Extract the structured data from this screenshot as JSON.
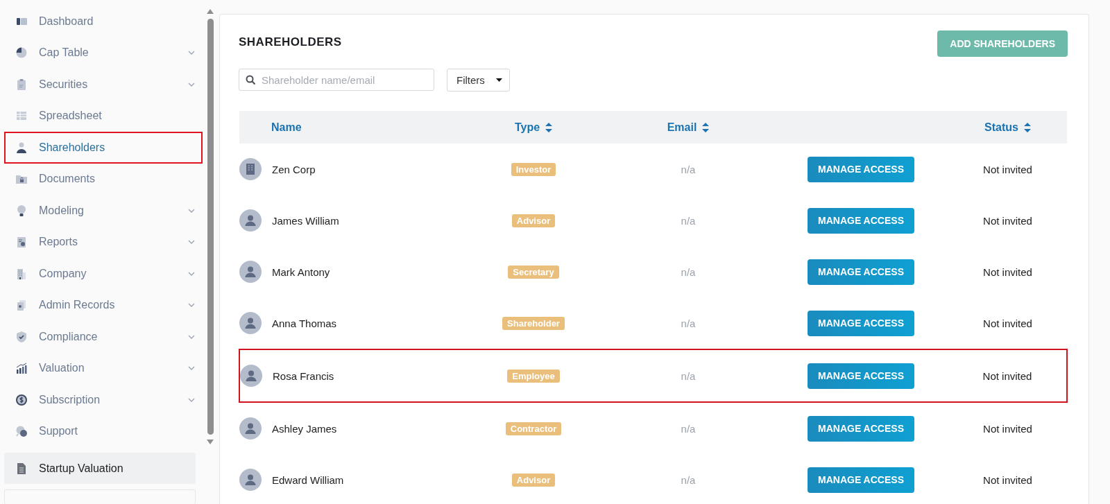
{
  "sidebar": {
    "items": [
      {
        "label": "Dashboard",
        "expandable": false,
        "selected": false,
        "highlighted": false
      },
      {
        "label": "Cap Table",
        "expandable": true,
        "selected": false,
        "highlighted": false
      },
      {
        "label": "Securities",
        "expandable": true,
        "selected": false,
        "highlighted": false
      },
      {
        "label": "Spreadsheet",
        "expandable": false,
        "selected": false,
        "highlighted": false
      },
      {
        "label": "Shareholders",
        "expandable": false,
        "selected": true,
        "highlighted": true
      },
      {
        "label": "Documents",
        "expandable": false,
        "selected": false,
        "highlighted": false
      },
      {
        "label": "Modeling",
        "expandable": true,
        "selected": false,
        "highlighted": false
      },
      {
        "label": "Reports",
        "expandable": true,
        "selected": false,
        "highlighted": false
      },
      {
        "label": "Company",
        "expandable": true,
        "selected": false,
        "highlighted": false
      },
      {
        "label": "Admin Records",
        "expandable": true,
        "selected": false,
        "highlighted": false
      },
      {
        "label": "Compliance",
        "expandable": true,
        "selected": false,
        "highlighted": false
      },
      {
        "label": "Valuation",
        "expandable": true,
        "selected": false,
        "highlighted": false
      },
      {
        "label": "Subscription",
        "expandable": true,
        "selected": false,
        "highlighted": false
      },
      {
        "label": "Support",
        "expandable": false,
        "selected": false,
        "highlighted": false
      }
    ],
    "footer_item": {
      "label": "Startup Valuation"
    }
  },
  "panel": {
    "title": "SHAREHOLDERS",
    "add_button": "ADD SHAREHOLDERS",
    "search": {
      "placeholder": "Shareholder name/email"
    },
    "filter": {
      "label": "Filters"
    }
  },
  "table": {
    "columns": [
      {
        "label": "Name",
        "sortable": false
      },
      {
        "label": "Type",
        "sortable": true
      },
      {
        "label": "Email",
        "sortable": true
      },
      {
        "sortable": false
      },
      {
        "label": "Status",
        "sortable": true
      }
    ],
    "rows": [
      {
        "name": "Zen Corp",
        "kind": "company",
        "type": "Investor",
        "email": "n/a",
        "action": "MANAGE ACCESS",
        "status": "Not invited",
        "highlighted": false
      },
      {
        "name": "James William",
        "kind": "person",
        "type": "Advisor",
        "email": "n/a",
        "action": "MANAGE ACCESS",
        "status": "Not invited",
        "highlighted": false
      },
      {
        "name": "Mark Antony",
        "kind": "person",
        "type": "Secretary",
        "email": "n/a",
        "action": "MANAGE ACCESS",
        "status": "Not invited",
        "highlighted": false
      },
      {
        "name": "Anna Thomas",
        "kind": "person",
        "type": "Shareholder",
        "email": "n/a",
        "action": "MANAGE ACCESS",
        "status": "Not invited",
        "highlighted": false
      },
      {
        "name": "Rosa Francis",
        "kind": "person",
        "type": "Employee",
        "email": "n/a",
        "action": "MANAGE ACCESS",
        "status": "Not invited",
        "highlighted": true
      },
      {
        "name": "Ashley James",
        "kind": "person",
        "type": "Contractor",
        "email": "n/a",
        "action": "MANAGE ACCESS",
        "status": "Not invited",
        "highlighted": false
      },
      {
        "name": "Edward William",
        "kind": "person",
        "type": "Advisor",
        "email": "n/a",
        "action": "MANAGE ACCESS",
        "status": "Not invited",
        "highlighted": false
      }
    ]
  }
}
